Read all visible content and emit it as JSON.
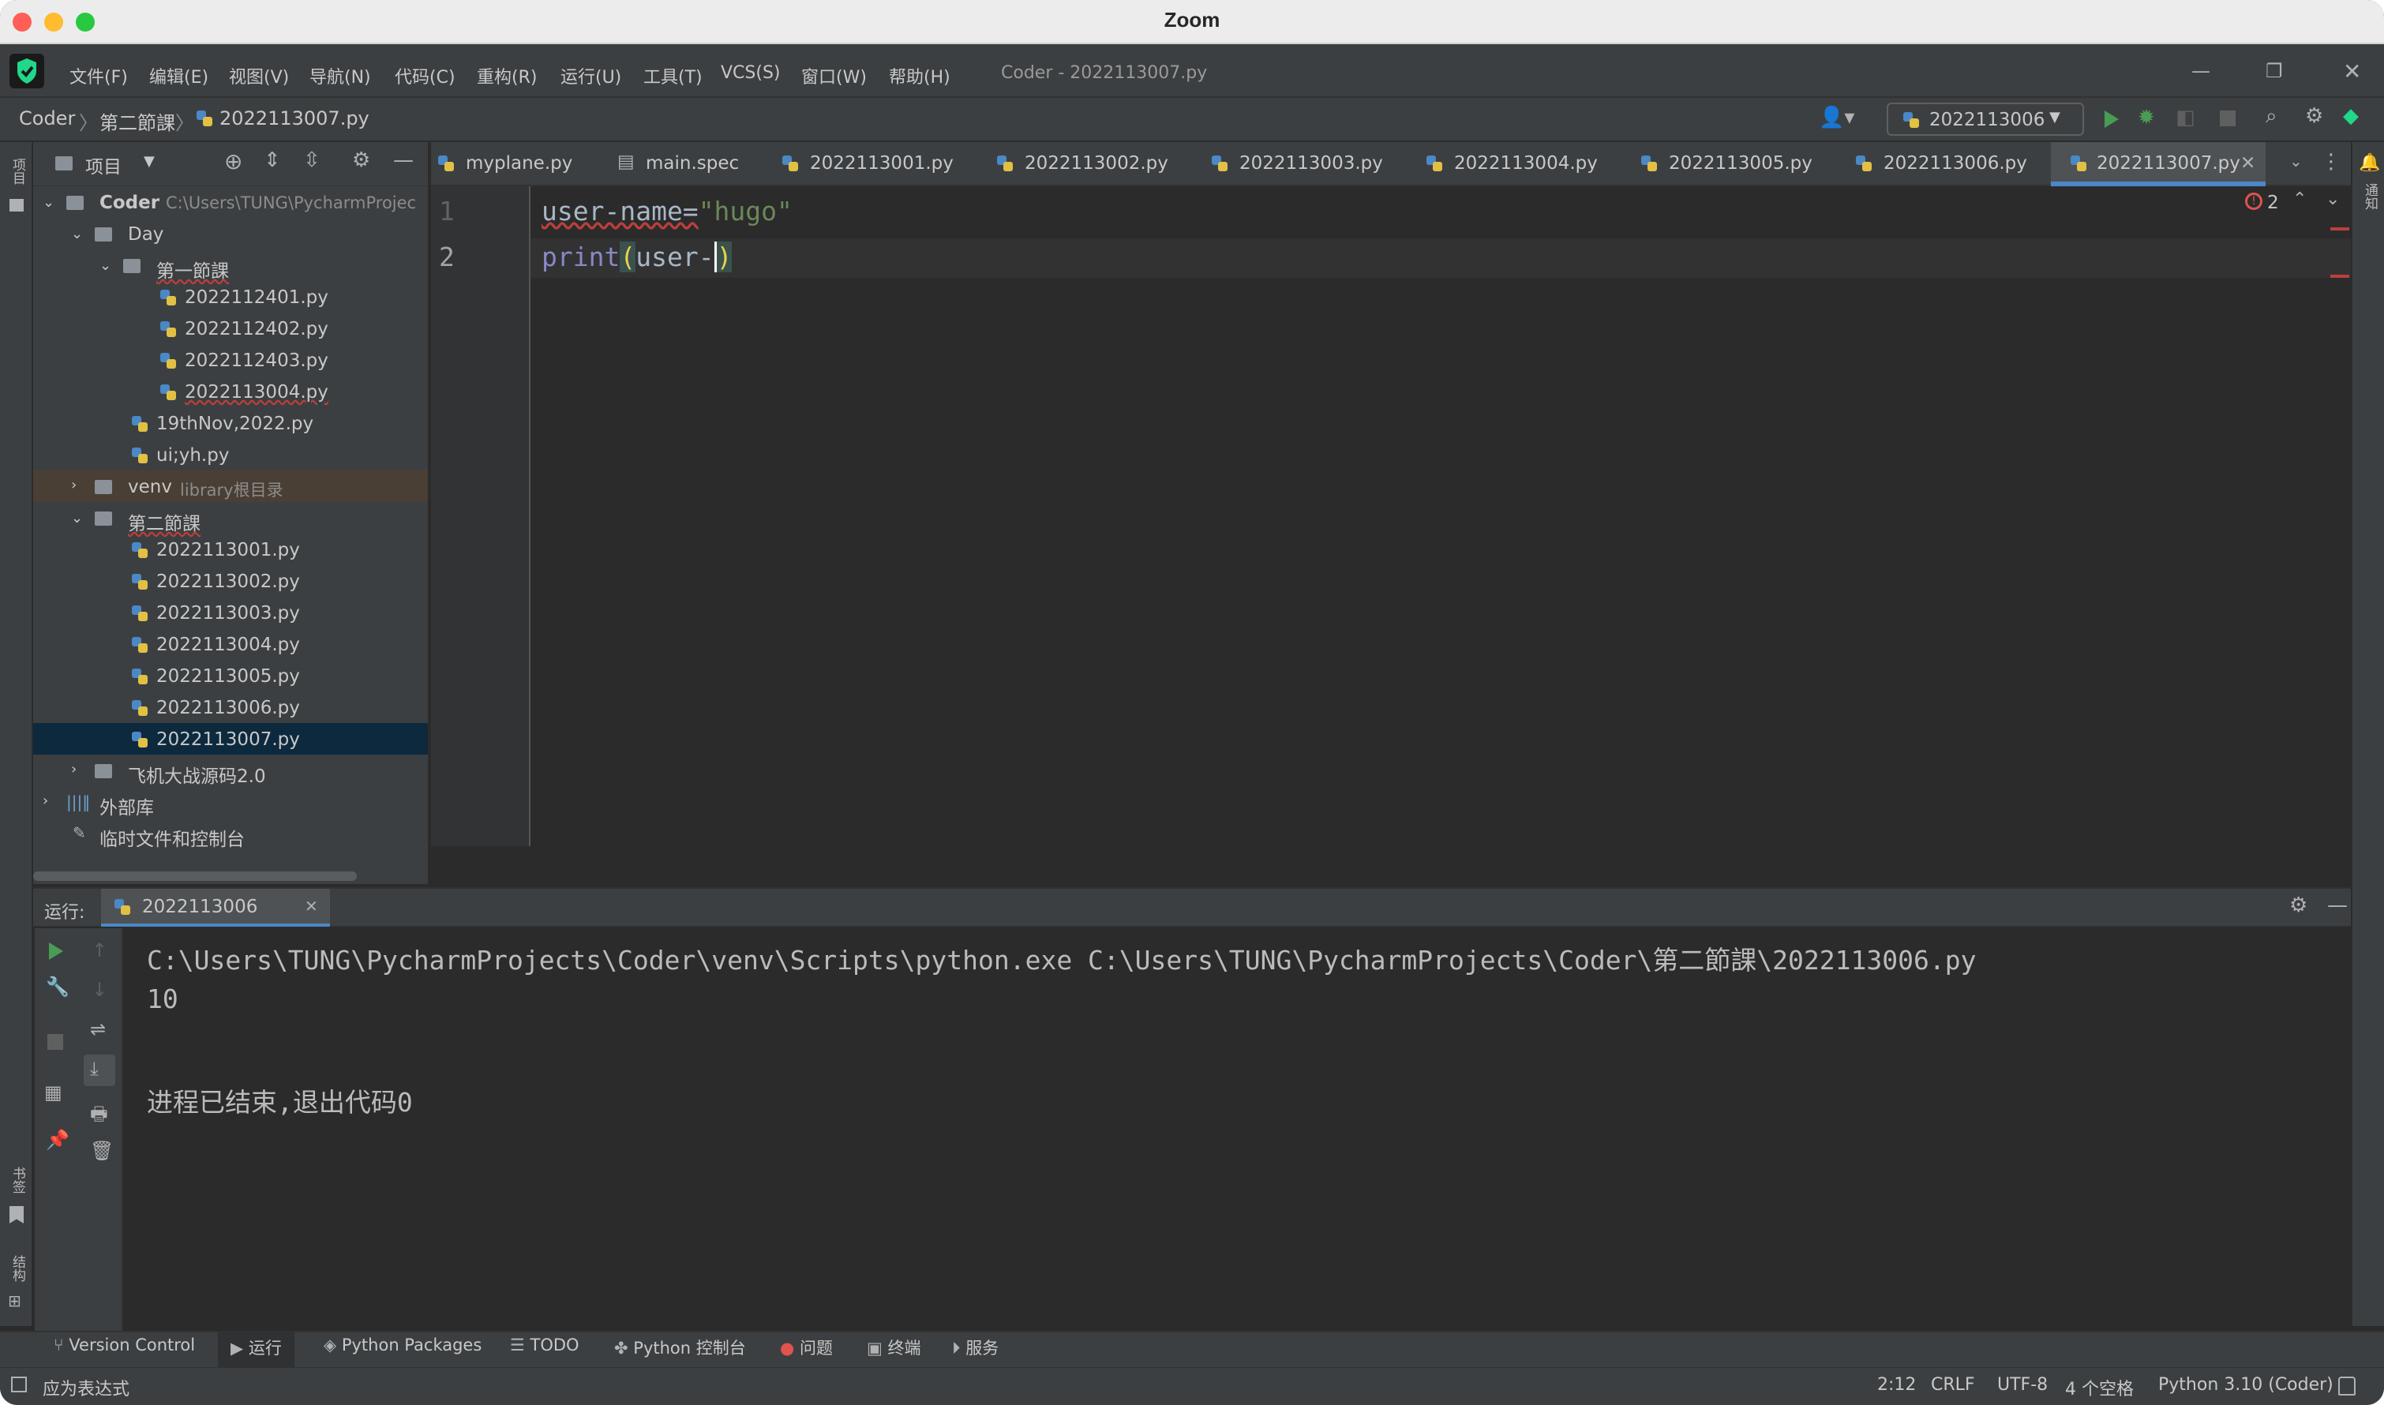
{
  "window": {
    "title": "Zoom"
  },
  "menubar": {
    "items": [
      "文件(F)",
      "编辑(E)",
      "视图(V)",
      "导航(N)",
      "代码(C)",
      "重构(R)",
      "运行(U)",
      "工具(T)",
      "VCS(S)",
      "窗口(W)",
      "帮助(H)"
    ],
    "project_title": "Coder - 2022113007.py"
  },
  "breadcrumb": [
    "Coder",
    "第二節課",
    "2022113007.py"
  ],
  "run_config": {
    "selected": "2022113006"
  },
  "project_panel": {
    "title": "项目",
    "tree": [
      {
        "label": "Coder",
        "path": "C:\\Users\\TUNG\\PycharmProjec",
        "type": "folder",
        "depth": 0,
        "expanded": true
      },
      {
        "label": "Day",
        "type": "folder",
        "depth": 1,
        "expanded": true
      },
      {
        "label": "第一節課",
        "type": "folder",
        "depth": 2,
        "expanded": true
      },
      {
        "label": "2022112401.py",
        "type": "py",
        "depth": 3
      },
      {
        "label": "2022112402.py",
        "type": "py",
        "depth": 3
      },
      {
        "label": "2022112403.py",
        "type": "py",
        "depth": 3
      },
      {
        "label": "2022113004.py",
        "type": "py",
        "depth": 3
      },
      {
        "label": "19thNov,2022.py",
        "type": "py",
        "depth": 2
      },
      {
        "label": "ui;yh.py",
        "type": "py",
        "depth": 2
      },
      {
        "label": "venv",
        "note": "library根目录",
        "type": "folder",
        "depth": 1,
        "expanded": false
      },
      {
        "label": "第二節課",
        "type": "folder",
        "depth": 1,
        "expanded": true
      },
      {
        "label": "2022113001.py",
        "type": "py",
        "depth": 2
      },
      {
        "label": "2022113002.py",
        "type": "py",
        "depth": 2
      },
      {
        "label": "2022113003.py",
        "type": "py",
        "depth": 2
      },
      {
        "label": "2022113004.py",
        "type": "py",
        "depth": 2
      },
      {
        "label": "2022113005.py",
        "type": "py",
        "depth": 2
      },
      {
        "label": "2022113006.py",
        "type": "py",
        "depth": 2
      },
      {
        "label": "2022113007.py",
        "type": "py",
        "depth": 2,
        "selected": true
      },
      {
        "label": "飞机大战源码2.0",
        "type": "folder",
        "depth": 1,
        "expanded": false
      },
      {
        "label": "外部库",
        "type": "lib",
        "depth": 0,
        "expanded": false
      },
      {
        "label": "临时文件和控制台",
        "type": "scratch",
        "depth": 0
      }
    ]
  },
  "tabs": [
    {
      "label": "myplane.py"
    },
    {
      "label": "main.spec"
    },
    {
      "label": "2022113001.py"
    },
    {
      "label": "2022113002.py"
    },
    {
      "label": "2022113003.py"
    },
    {
      "label": "2022113004.py"
    },
    {
      "label": "2022113005.py"
    },
    {
      "label": "2022113006.py"
    },
    {
      "label": "2022113007.py",
      "active": true
    }
  ],
  "editor": {
    "line_numbers": [
      "1",
      "2"
    ],
    "line1": {
      "a": "user-name=",
      "b": "\"hugo\""
    },
    "line2": {
      "a": "print",
      "b": "(",
      "c": "user-",
      "d": ")"
    },
    "error_count": "2"
  },
  "run_panel": {
    "label": "运行:",
    "tab": "2022113006",
    "output": [
      "C:\\Users\\TUNG\\PycharmProjects\\Coder\\venv\\Scripts\\python.exe C:\\Users\\TUNG\\PycharmProjects\\Coder\\第二節課\\2022113006.py",
      "10",
      "",
      "进程已结束,退出代码0"
    ]
  },
  "left_strip": {
    "top": "项目",
    "bookmarks": "书签",
    "structure": "结构"
  },
  "right_strip": {
    "label": "通知"
  },
  "bottom_tabs": [
    "Version Control",
    "运行",
    "Python Packages",
    "TODO",
    "Python 控制台",
    "问题",
    "终端",
    "服务"
  ],
  "statusbar": {
    "message": "应为表达式",
    "position": "2:12",
    "line_ending": "CRLF",
    "encoding": "UTF-8",
    "indent": "4 个空格",
    "interpreter": "Python 3.10 (Coder)"
  },
  "colors": {
    "accent": "#4a88c7",
    "selection": "#0d293e",
    "error": "#e0534e",
    "run_green": "#499c54",
    "string": "#6a8759",
    "keyword_builtin": "#8888c6"
  }
}
